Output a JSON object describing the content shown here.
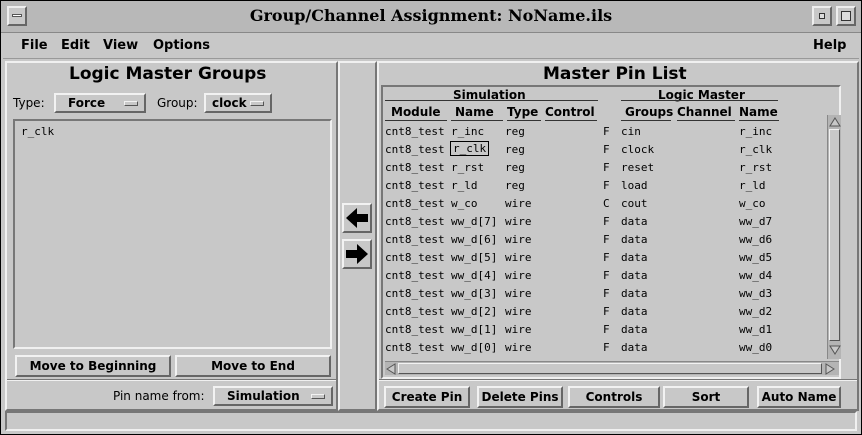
{
  "window": {
    "title": "Group/Channel Assignment: NoName.ils"
  },
  "menubar": {
    "file": "File",
    "edit": "Edit",
    "view": "View",
    "options": "Options",
    "help": "Help"
  },
  "left": {
    "title": "Logic Master Groups",
    "type_label": "Type:",
    "type_value": "Force",
    "group_label": "Group:",
    "group_value": "clock",
    "list_items": [
      "r_clk"
    ],
    "move_begin": "Move to Beginning",
    "move_end": "Move to End",
    "pin_from_label": "Pin name from:",
    "pin_from_value": "Simulation"
  },
  "right": {
    "title": "Master Pin List",
    "sim_header": "Simulation",
    "lm_header": "Logic Master",
    "columns": [
      "Module",
      "Name",
      "Type",
      "Control",
      "Groups",
      "Channel",
      "Name"
    ],
    "rows": [
      [
        "cnt8_test",
        "r_inc",
        "reg",
        "F",
        "cin",
        "r_inc"
      ],
      [
        "cnt8_test",
        "r_clk",
        "reg",
        "F",
        "clock",
        "r_clk"
      ],
      [
        "cnt8_test",
        "r_rst",
        "reg",
        "F",
        "reset",
        "r_rst"
      ],
      [
        "cnt8_test",
        "r_ld",
        "reg",
        "F",
        "load",
        "r_ld"
      ],
      [
        "cnt8_test",
        "w_co",
        "wire",
        "C",
        "cout",
        "w_co"
      ],
      [
        "cnt8_test",
        "ww_d[7]",
        "wire",
        "F",
        "data",
        "ww_d7"
      ],
      [
        "cnt8_test",
        "ww_d[6]",
        "wire",
        "F",
        "data",
        "ww_d6"
      ],
      [
        "cnt8_test",
        "ww_d[5]",
        "wire",
        "F",
        "data",
        "ww_d5"
      ],
      [
        "cnt8_test",
        "ww_d[4]",
        "wire",
        "F",
        "data",
        "ww_d4"
      ],
      [
        "cnt8_test",
        "ww_d[3]",
        "wire",
        "F",
        "data",
        "ww_d3"
      ],
      [
        "cnt8_test",
        "ww_d[2]",
        "wire",
        "F",
        "data",
        "ww_d2"
      ],
      [
        "cnt8_test",
        "ww_d[1]",
        "wire",
        "F",
        "data",
        "ww_d1"
      ],
      [
        "cnt8_test",
        "ww_d[0]",
        "wire",
        "F",
        "data",
        "ww_d0"
      ]
    ],
    "buttons": {
      "create": "Create Pin",
      "delete": "Delete Pins",
      "controls": "Controls",
      "sort": "Sort",
      "auto": "Auto Name"
    }
  },
  "icons": {
    "left_arrow": "left-arrow-icon",
    "right_arrow": "right-arrow-icon"
  }
}
